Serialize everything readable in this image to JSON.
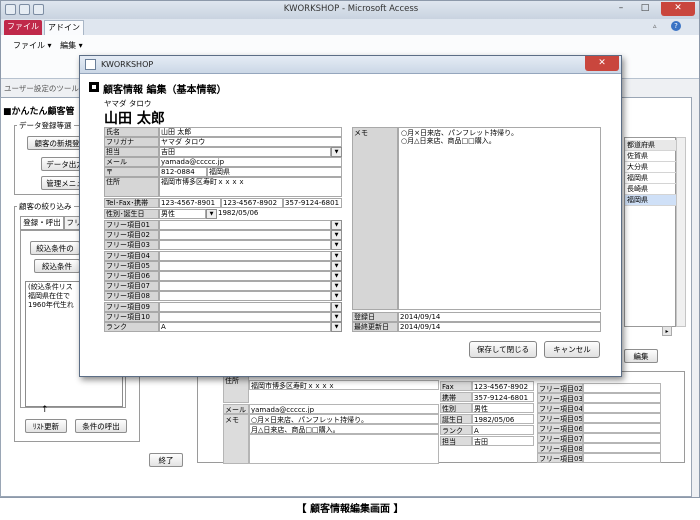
{
  "window": {
    "title": "KWORKSHOP - Microsoft Access",
    "min": "–",
    "max": "□",
    "close": "✕"
  },
  "ribbon": {
    "tab_file": "ファイル",
    "tab_addin": "アドイン",
    "menu_file": "ファイル ▾",
    "menu_edit": "編集 ▾",
    "group_label": "ユーザー設定のツール"
  },
  "bgform": {
    "title": "■かんたん顧客管",
    "group1_label": "データ登録等選",
    "btn_new": "顧客の新規登",
    "btn_export": "データ出力",
    "btn_admin": "管理メニュ",
    "group2_label": "顧客の絞り込み",
    "tab_register": "登録・呼出",
    "tab_filter": "フリ",
    "btn_filter1": "絞込条件の",
    "btn_filter2": "絞込条件",
    "listbox_lines": [
      "(絞込条件リス",
      "福岡県在住で",
      "1960年代生れ"
    ],
    "arrow": "↑",
    "btn_list_update": "ﾘｽﾄ更新",
    "btn_condition_call": "条件の呼出",
    "btn_exit": "終了",
    "btn_edit_partial": "編集",
    "pref_header": "都道府県",
    "prefs": [
      "佐賀県",
      "大分県",
      "福岡県",
      "長崎県",
      "福岡県"
    ],
    "detail": {
      "addr_label": "住所",
      "addr_value": "福岡市博多区寿町ｘｘｘｘ",
      "mail_label": "メール",
      "mail_value": "yamada@ccccc.jp",
      "memo_label": "メモ",
      "memo_line1": "○月×日来店、パンフレット持帰り。",
      "memo_line2": "月△日来店、商品□□購入。",
      "mid_labels": [
        "Fax",
        "携帯",
        "性別",
        "誕生日",
        "ランク",
        "担当"
      ],
      "mid_values": [
        "123-4567-8902",
        "357-9124-6801",
        "男性",
        "1982/05/06",
        "A",
        "吉田"
      ],
      "free_labels": [
        "フリー項目02",
        "フリー項目03",
        "フリー項目04",
        "フリー項目05",
        "フリー項目06",
        "フリー項目07",
        "フリー項目08",
        "フリー項目09"
      ]
    }
  },
  "dialog": {
    "title": "KWORKSHOP",
    "heading": "顧客情報 編集（基本情報）",
    "ruby": "ヤマダ タロウ",
    "name": "山田  太郎",
    "fields": [
      {
        "label": "氏名",
        "value": "山田 太郎"
      },
      {
        "label": "フリガナ",
        "value": "ヤマダ タロウ"
      },
      {
        "label": "担当",
        "value": "吉田"
      },
      {
        "label": "メール",
        "value": "yamada@ccccc.jp"
      },
      {
        "label": "〒",
        "value": "812-0884"
      },
      {
        "label": "住所",
        "value": "福岡市博多区寿町ｘｘｘｘ"
      }
    ],
    "pref_value": "福岡県",
    "tel_label": "Tel･Fax･携帯",
    "tel": "123-4567-8901",
    "fax": "123-4567-8902",
    "mobile": "357-9124-6801",
    "gender_label": "性別･誕生日",
    "gender": "男性",
    "birthday": "1982/05/06",
    "free_items": [
      "フリー項目01",
      "フリー項目02",
      "フリー項目03",
      "フリー項目04",
      "フリー項目05",
      "フリー項目06",
      "フリー項目07",
      "フリー項目08",
      "フリー項目09",
      "フリー項目10"
    ],
    "rank_label": "ランク",
    "rank": "A",
    "memo_label": "メモ",
    "memo_line1": "○月×日来店、パンフレット持帰り。",
    "memo_line2": "○月△日来店、商品□□購入。",
    "reg_label": "登録日",
    "reg_date": "2014/09/14",
    "upd_label": "最終更新日",
    "upd_date": "2014/09/14",
    "save_btn": "保存して閉じる",
    "cancel_btn": "キャンセル"
  },
  "caption": "【 顧客情報編集画面 】"
}
